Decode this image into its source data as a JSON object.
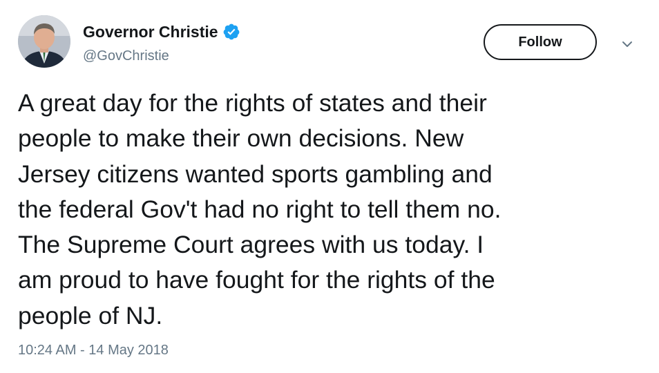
{
  "author": {
    "display_name": "Governor Christie",
    "handle": "@GovChristie",
    "verified": true,
    "avatar_icon": "profile-photo"
  },
  "actions": {
    "follow_label": "Follow",
    "more_icon": "chevron-down-icon"
  },
  "tweet": {
    "lines": [
      "A great day for the rights of states and their",
      "people to make their own decisions. New",
      "Jersey citizens wanted sports gambling and",
      "the federal Gov't had no right to tell them no.",
      "The Supreme Court agrees with us today. I",
      "am proud to have fought for the rights of the",
      "people of NJ."
    ],
    "timestamp": "10:24 AM - 14 May 2018"
  },
  "colors": {
    "text_primary": "#14171a",
    "text_secondary": "#657786",
    "verified_blue": "#1da1f2",
    "background": "#ffffff"
  }
}
